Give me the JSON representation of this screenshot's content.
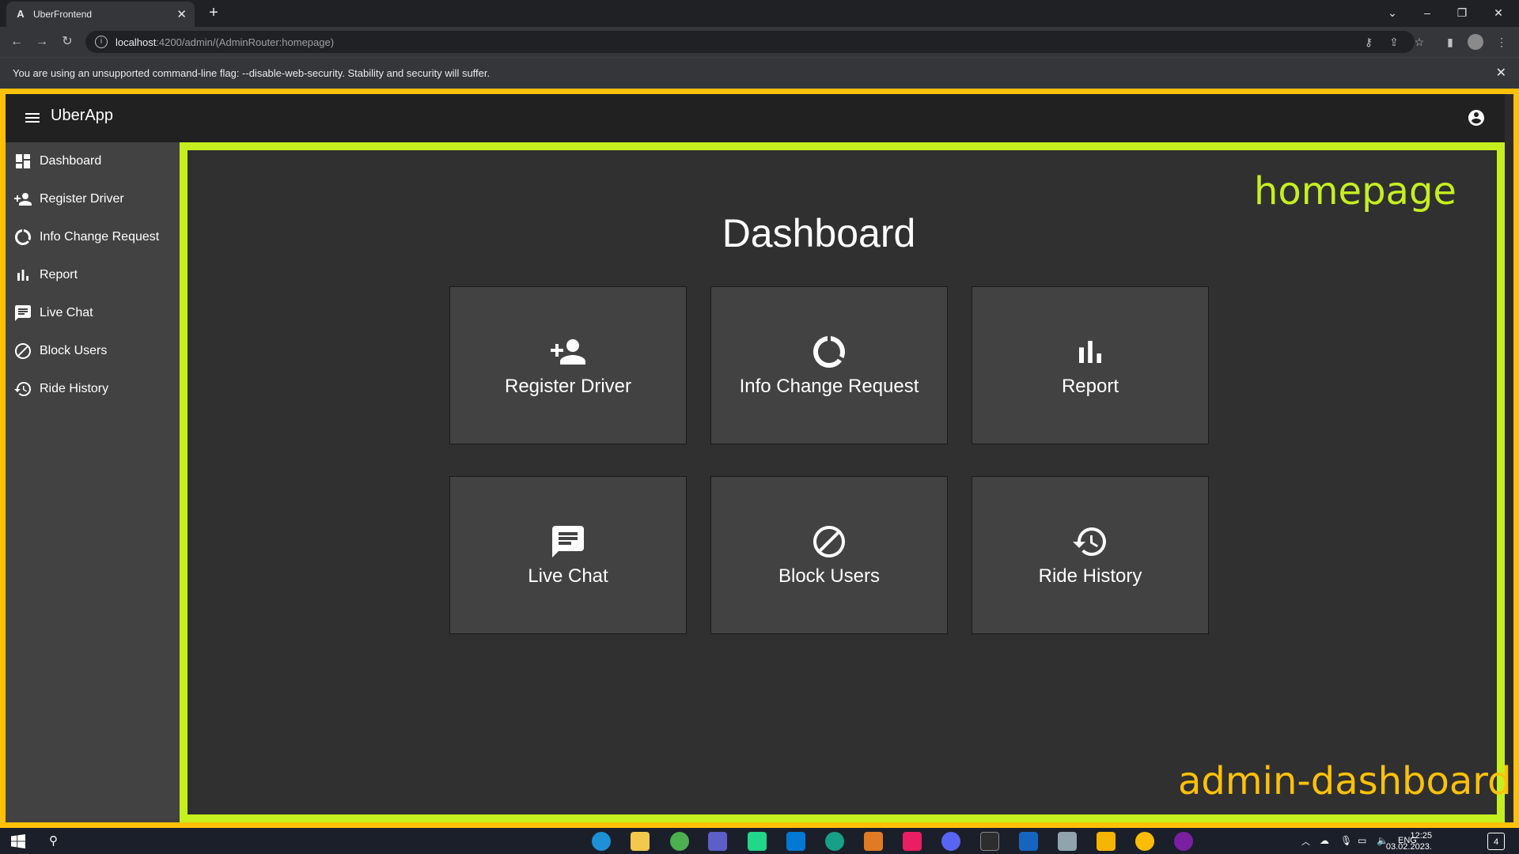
{
  "browser": {
    "tab_title": "UberFrontend",
    "tab_favicon": "A",
    "new_tab": "+",
    "url_host": "localhost",
    "url_path": ":4200/admin/(AdminRouter:homepage)",
    "warning": "You are using an unsupported command-line flag: --disable-web-security. Stability and security will suffer."
  },
  "app": {
    "title": "UberApp",
    "colors": {
      "outer_border": "#ffc107",
      "content_border": "#c6ef1e",
      "header": "#212121",
      "sidebar": "#424242",
      "content": "#303030",
      "card": "#424242"
    }
  },
  "sidebar": {
    "items": [
      {
        "label": "Dashboard",
        "icon": "dashboard-icon"
      },
      {
        "label": "Register Driver",
        "icon": "person-add-icon"
      },
      {
        "label": "Info Change Request",
        "icon": "refresh-icon"
      },
      {
        "label": "Report",
        "icon": "bar-chart-icon"
      },
      {
        "label": "Live Chat",
        "icon": "chat-icon"
      },
      {
        "label": "Block Users",
        "icon": "block-icon"
      },
      {
        "label": "Ride History",
        "icon": "history-icon"
      }
    ]
  },
  "main": {
    "title": "Dashboard",
    "annotation_inner": "homepage",
    "annotation_outer": "admin-dashboard",
    "cards": [
      {
        "label": "Register Driver",
        "icon": "person-add-icon"
      },
      {
        "label": "Info Change Request",
        "icon": "refresh-icon"
      },
      {
        "label": "Report",
        "icon": "bar-chart-icon"
      },
      {
        "label": "Live Chat",
        "icon": "chat-icon"
      },
      {
        "label": "Block Users",
        "icon": "block-icon"
      },
      {
        "label": "Ride History",
        "icon": "history-icon"
      }
    ]
  },
  "taskbar": {
    "lang": "ENG",
    "time": "12:25",
    "date": "03.02.2023.",
    "notifications": "4"
  }
}
